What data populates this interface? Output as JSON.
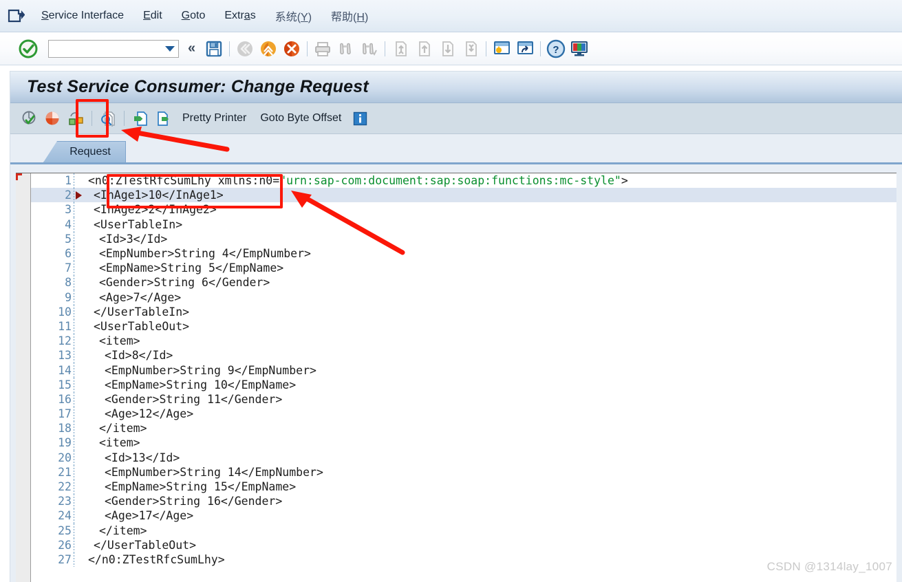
{
  "window": {
    "system_icon": "sap-system-menu-icon"
  },
  "menubar": {
    "items": [
      {
        "label": "Service Interface",
        "accel": "S",
        "lang": "en"
      },
      {
        "label": "Edit",
        "accel": "E",
        "lang": "en"
      },
      {
        "label": "Goto",
        "accel": "G",
        "lang": "en"
      },
      {
        "label": "Extras",
        "accel": "a",
        "lang": "en"
      },
      {
        "label": "系统(Y)",
        "accel": "Y",
        "lang": "cn"
      },
      {
        "label": "帮助(H)",
        "accel": "H",
        "lang": "cn"
      }
    ]
  },
  "toolbar": {
    "enter_icon": "green-check-enter-icon",
    "command_field_value": "",
    "command_field_placeholder": "",
    "dropdown_icon": "chevron-down-icon",
    "collapse_icon": "double-chevron-left-icon",
    "buttons": [
      {
        "name": "save-button",
        "icon": "floppy-disk-icon",
        "enabled": true
      },
      {
        "name": "back-button",
        "icon": "green-back-arrow-icon",
        "enabled": false
      },
      {
        "name": "exit-button",
        "icon": "yellow-exit-up-icon",
        "enabled": true
      },
      {
        "name": "cancel-button",
        "icon": "red-cancel-x-icon",
        "enabled": true
      },
      {
        "name": "print-button",
        "icon": "printer-icon",
        "enabled": false
      },
      {
        "name": "find-button",
        "icon": "binoculars-icon",
        "enabled": false
      },
      {
        "name": "find-next-button",
        "icon": "binoculars-plus-icon",
        "enabled": false
      },
      {
        "name": "first-page-button",
        "icon": "page-first-icon",
        "enabled": false
      },
      {
        "name": "previous-page-button",
        "icon": "page-up-icon",
        "enabled": false
      },
      {
        "name": "next-page-button",
        "icon": "page-down-icon",
        "enabled": false
      },
      {
        "name": "last-page-button",
        "icon": "page-last-icon",
        "enabled": false
      },
      {
        "name": "create-session-button",
        "icon": "new-session-icon",
        "enabled": true
      },
      {
        "name": "create-shortcut-button",
        "icon": "shortcut-icon",
        "enabled": true
      },
      {
        "name": "help-button",
        "icon": "question-mark-help-icon",
        "enabled": true
      },
      {
        "name": "customize-layout-button",
        "icon": "monitor-layout-icon",
        "enabled": true
      }
    ]
  },
  "page": {
    "title": "Test Service Consumer: Change Request"
  },
  "apptoolbar": {
    "buttons": [
      {
        "name": "check-button",
        "icon": "check-syntax-icon"
      },
      {
        "name": "activate-button",
        "icon": "activate-red-ball-icon"
      },
      {
        "name": "where-used-button",
        "icon": "where-used-list-icon"
      },
      {
        "name": "test-button",
        "icon": "test-document-magnifier-icon",
        "highlighted": true
      },
      {
        "name": "import-button",
        "icon": "import-green-arrow-icon"
      },
      {
        "name": "export-button",
        "icon": "export-green-arrow-icon"
      }
    ],
    "labels": [
      {
        "name": "pretty-printer-button",
        "text": "Pretty Printer"
      },
      {
        "name": "goto-byte-offset-button",
        "text": "Goto Byte Offset"
      }
    ],
    "info_icon": "information-blue-i-icon"
  },
  "tabs": [
    {
      "name": "tab-request",
      "label": "Request",
      "active": true
    }
  ],
  "editor": {
    "lines": [
      {
        "no": "1",
        "indent": 0,
        "text": "<n0:ZTestRfcSumLhy xmlns:n0=",
        "quoted": "\"urn:sap-com:document:sap:soap:functions:mc-style\"",
        "tail": ">",
        "highlight": false,
        "marker": false
      },
      {
        "no": "2",
        "indent": 1,
        "text": "<InAge1>10</InAge1>",
        "highlight": true,
        "marker": true
      },
      {
        "no": "3",
        "indent": 1,
        "text": "<InAge2>2</InAge2>",
        "highlight": false,
        "marker": false
      },
      {
        "no": "4",
        "indent": 1,
        "text": "<UserTableIn>",
        "highlight": false,
        "marker": false
      },
      {
        "no": "5",
        "indent": 2,
        "text": "<Id>3</Id>",
        "highlight": false,
        "marker": false
      },
      {
        "no": "6",
        "indent": 2,
        "text": "<EmpNumber>String 4</EmpNumber>",
        "highlight": false,
        "marker": false
      },
      {
        "no": "7",
        "indent": 2,
        "text": "<EmpName>String 5</EmpName>",
        "highlight": false,
        "marker": false
      },
      {
        "no": "8",
        "indent": 2,
        "text": "<Gender>String 6</Gender>",
        "highlight": false,
        "marker": false
      },
      {
        "no": "9",
        "indent": 2,
        "text": "<Age>7</Age>",
        "highlight": false,
        "marker": false
      },
      {
        "no": "10",
        "indent": 1,
        "text": "</UserTableIn>",
        "highlight": false,
        "marker": false
      },
      {
        "no": "11",
        "indent": 1,
        "text": "<UserTableOut>",
        "highlight": false,
        "marker": false
      },
      {
        "no": "12",
        "indent": 2,
        "text": "<item>",
        "highlight": false,
        "marker": false
      },
      {
        "no": "13",
        "indent": 3,
        "text": "<Id>8</Id>",
        "highlight": false,
        "marker": false
      },
      {
        "no": "14",
        "indent": 3,
        "text": "<EmpNumber>String 9</EmpNumber>",
        "highlight": false,
        "marker": false
      },
      {
        "no": "15",
        "indent": 3,
        "text": "<EmpName>String 10</EmpName>",
        "highlight": false,
        "marker": false
      },
      {
        "no": "16",
        "indent": 3,
        "text": "<Gender>String 11</Gender>",
        "highlight": false,
        "marker": false
      },
      {
        "no": "17",
        "indent": 3,
        "text": "<Age>12</Age>",
        "highlight": false,
        "marker": false
      },
      {
        "no": "18",
        "indent": 2,
        "text": "</item>",
        "highlight": false,
        "marker": false
      },
      {
        "no": "19",
        "indent": 2,
        "text": "<item>",
        "highlight": false,
        "marker": false
      },
      {
        "no": "20",
        "indent": 3,
        "text": "<Id>13</Id>",
        "highlight": false,
        "marker": false
      },
      {
        "no": "21",
        "indent": 3,
        "text": "<EmpNumber>String 14</EmpNumber>",
        "highlight": false,
        "marker": false
      },
      {
        "no": "22",
        "indent": 3,
        "text": "<EmpName>String 15</EmpName>",
        "highlight": false,
        "marker": false
      },
      {
        "no": "23",
        "indent": 3,
        "text": "<Gender>String 16</Gender>",
        "highlight": false,
        "marker": false
      },
      {
        "no": "24",
        "indent": 3,
        "text": "<Age>17</Age>",
        "highlight": false,
        "marker": false
      },
      {
        "no": "25",
        "indent": 2,
        "text": "</item>",
        "highlight": false,
        "marker": false
      },
      {
        "no": "26",
        "indent": 1,
        "text": "</UserTableOut>",
        "highlight": false,
        "marker": false
      },
      {
        "no": "27",
        "indent": 0,
        "text": "</n0:ZTestRfcSumLhy>",
        "highlight": false,
        "marker": false
      }
    ]
  },
  "annotations": {
    "color": "#fb1708",
    "highlight_box_toolbar": "test-button-highlight-box",
    "highlight_box_code": "inage-lines-highlight-box",
    "arrow_toolbar": "arrow-pointing-to-test-button",
    "arrow_code": "arrow-pointing-to-inage-lines"
  },
  "watermark": {
    "text": "CSDN @1314lay_1007"
  },
  "colors": {
    "accent": "#7fa5cd",
    "annotation_red": "#fb1708",
    "string_green": "#0a8f2f",
    "line_number": "#5b87ad",
    "selection": "#dae3f0"
  }
}
